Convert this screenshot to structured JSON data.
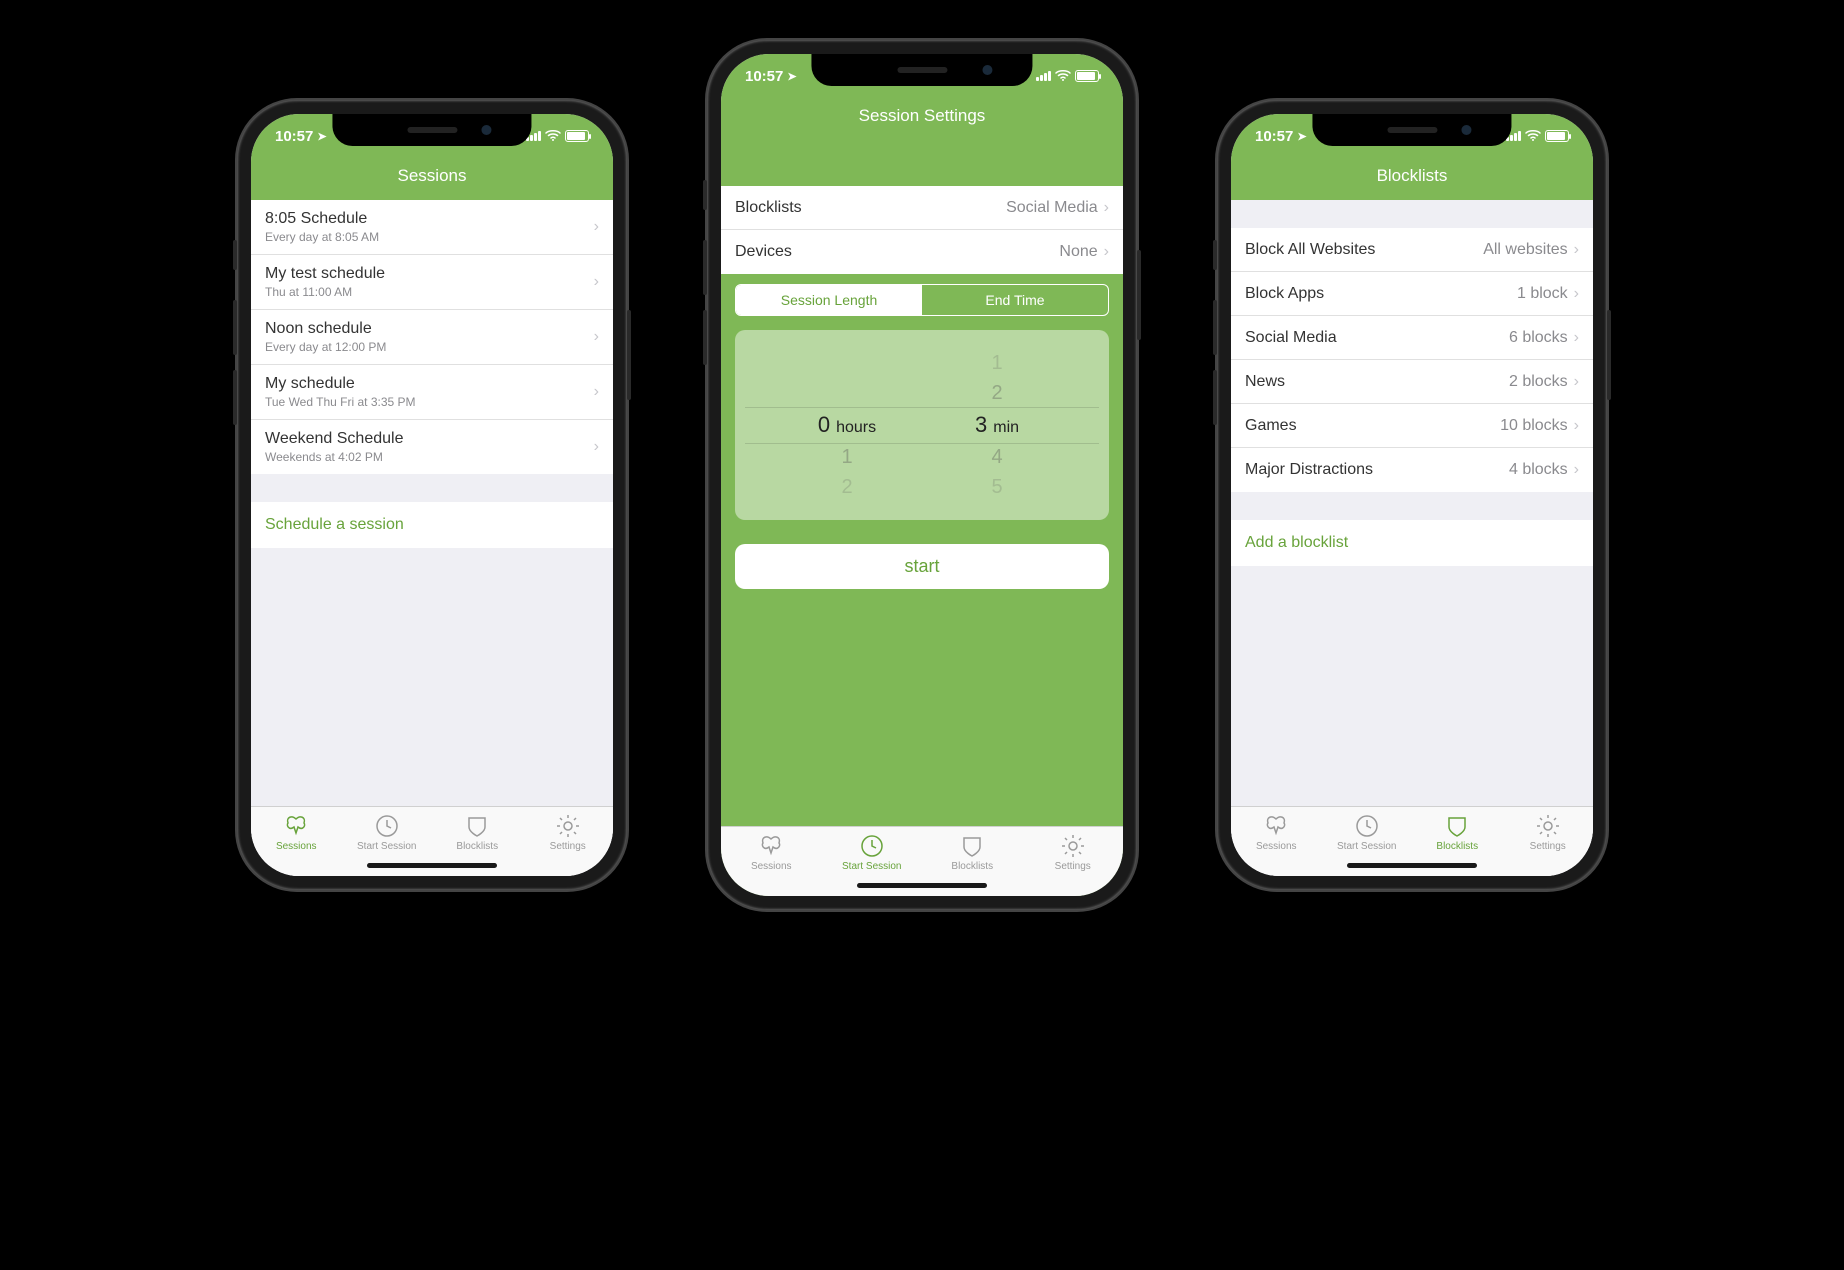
{
  "status": {
    "time": "10:57"
  },
  "colors": {
    "accent": "#7fb856",
    "accent_text": "#68a33b"
  },
  "tabs": {
    "sessions": "Sessions",
    "start": "Start Session",
    "blocklists": "Blocklists",
    "settings": "Settings"
  },
  "phone1": {
    "header": "Sessions",
    "items": [
      {
        "title": "8:05 Schedule",
        "sub": "Every day at 8:05 AM"
      },
      {
        "title": "My test schedule",
        "sub": "Thu at 11:00 AM"
      },
      {
        "title": "Noon schedule",
        "sub": "Every day at 12:00 PM"
      },
      {
        "title": "My schedule",
        "sub": "Tue Wed Thu Fri at 3:35 PM"
      },
      {
        "title": "Weekend Schedule",
        "sub": "Weekends at 4:02 PM"
      }
    ],
    "action": "Schedule a session"
  },
  "phone2": {
    "header": "Session Settings",
    "rows": {
      "blocklists_label": "Blocklists",
      "blocklists_value": "Social Media",
      "devices_label": "Devices",
      "devices_value": "None"
    },
    "segmented": {
      "length": "Session Length",
      "end": "End Time"
    },
    "picker": {
      "hours_value": "0",
      "hours_unit": "hours",
      "min_value": "3",
      "min_unit": "min",
      "h_above1": "",
      "h_above2": "",
      "h_below1": "1",
      "h_below2": "2",
      "m_above1": "1",
      "m_above2": "2",
      "m_below1": "4",
      "m_below2": "5"
    },
    "start": "start"
  },
  "phone3": {
    "header": "Blocklists",
    "items": [
      {
        "title": "Block All Websites",
        "value": "All websites"
      },
      {
        "title": "Block Apps",
        "value": "1 block"
      },
      {
        "title": "Social Media",
        "value": "6 blocks"
      },
      {
        "title": "News",
        "value": "2 blocks"
      },
      {
        "title": "Games",
        "value": "10 blocks"
      },
      {
        "title": "Major Distractions",
        "value": "4 blocks"
      }
    ],
    "action": "Add a blocklist"
  }
}
